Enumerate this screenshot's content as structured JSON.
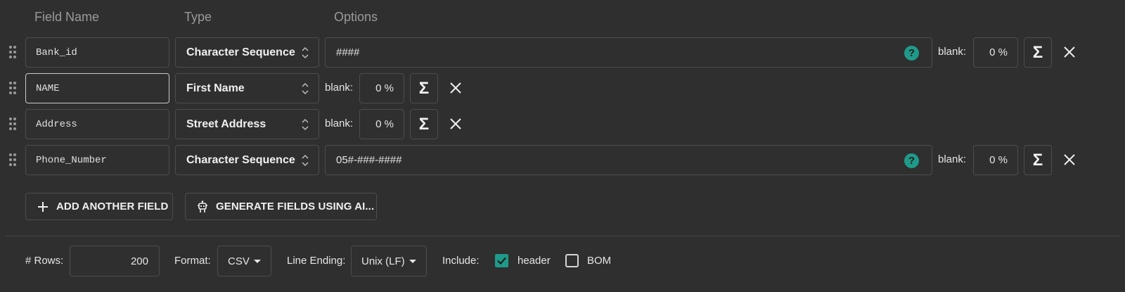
{
  "headers": {
    "field_name": "Field Name",
    "type": "Type",
    "options": "Options"
  },
  "fields": [
    {
      "name": "Bank_id",
      "type": "Character Sequence",
      "option": "####",
      "blank_label": "blank:",
      "blank_value": "0 %"
    },
    {
      "name": "NAME",
      "type": "First Name",
      "blank_label": "blank:",
      "blank_value": "0 %"
    },
    {
      "name": "Address",
      "type": "Street Address",
      "blank_label": "blank:",
      "blank_value": "0 %"
    },
    {
      "name": "Phone_Number",
      "type": "Character Sequence",
      "option": "05#-###-####",
      "blank_label": "blank:",
      "blank_value": "0 %"
    }
  ],
  "icons": {
    "help": "?",
    "sigma": "Σ"
  },
  "buttons": {
    "add_field": "ADD ANOTHER FIELD",
    "generate_ai": "GENERATE FIELDS USING AI..."
  },
  "footer": {
    "rows_label": "# Rows:",
    "rows_value": "200",
    "format_label": "Format:",
    "format_value": "CSV",
    "line_ending_label": "Line Ending:",
    "line_ending_value": "Unix (LF)",
    "include_label": "Include:",
    "header_label": "header",
    "header_checked": true,
    "bom_label": "BOM",
    "bom_checked": false
  },
  "colors": {
    "background": "#2f2f2f",
    "accent": "#1f9a8a",
    "border": "#4d4d4d"
  }
}
